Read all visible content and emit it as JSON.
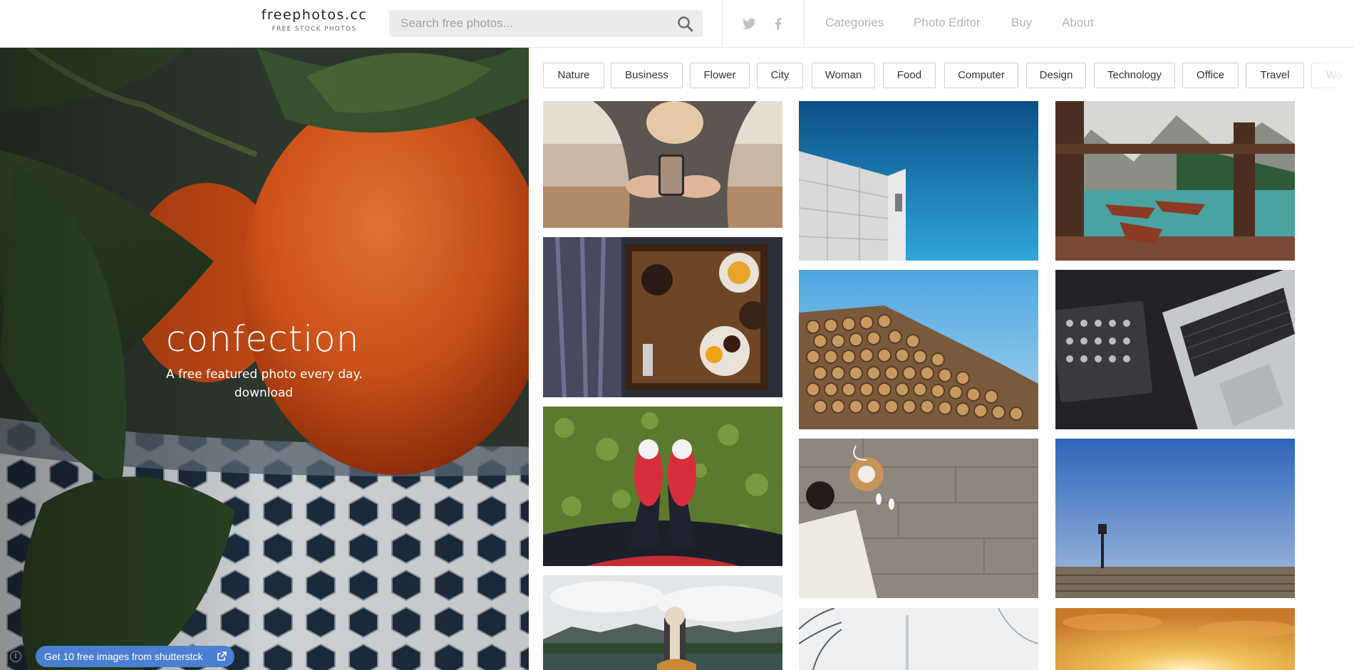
{
  "header": {
    "logo_title": "freephotos.cc",
    "logo_subtitle": "FREE STOCK PHOTOS",
    "search_placeholder": "Search free photos...",
    "social": [
      {
        "name": "twitter-icon"
      },
      {
        "name": "facebook-icon"
      }
    ],
    "nav": [
      {
        "label": "Categories"
      },
      {
        "label": "Photo Editor"
      },
      {
        "label": "Buy"
      },
      {
        "label": "About"
      }
    ]
  },
  "hero": {
    "title": "confection",
    "tagline": "A free featured photo every day.",
    "download_label": "download"
  },
  "promo": {
    "label": "Get 10 free images from shutterstck",
    "info_glyph": "i"
  },
  "categories": [
    "Nature",
    "Business",
    "Flower",
    "City",
    "Woman",
    "Food",
    "Computer",
    "Design",
    "Technology",
    "Office",
    "Travel",
    "Wo"
  ],
  "colors": {
    "accent_blue": "#4b7fd1",
    "nav_gray": "#b4b4b4",
    "search_bg": "#ececec"
  }
}
